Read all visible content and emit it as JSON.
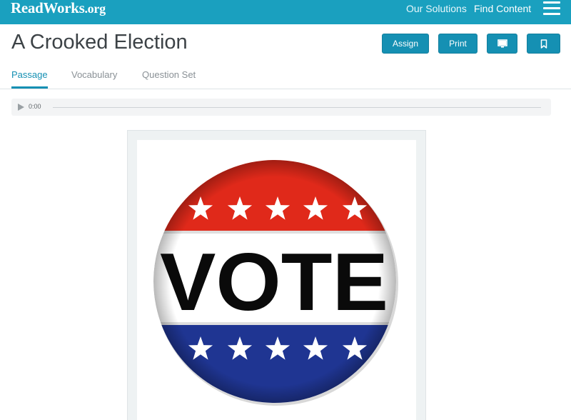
{
  "topbar": {
    "logo": "ReadWorks",
    "logo_tld": ".org",
    "links": [
      "Our Solutions",
      "Find Content"
    ],
    "menu_icon": "hamburger-menu-icon"
  },
  "header": {
    "title": "A Crooked Election",
    "buttons": {
      "assign": "Assign",
      "print": "Print",
      "present_icon": "monitor-icon",
      "bookmark_icon": "bookmark-icon"
    }
  },
  "tabs": [
    {
      "label": "Passage",
      "active": true
    },
    {
      "label": "Vocabulary",
      "active": false
    },
    {
      "label": "Question Set",
      "active": false
    }
  ],
  "audio": {
    "time": "0:00",
    "play_icon": "play-icon"
  },
  "image": {
    "text": "VOTE",
    "colors": {
      "red": "#e0291a",
      "blue": "#1f3592",
      "white": "#ffffff"
    }
  },
  "colors": {
    "brand": "#1aa0bf",
    "button": "#1590b3",
    "title": "#3c4246"
  }
}
